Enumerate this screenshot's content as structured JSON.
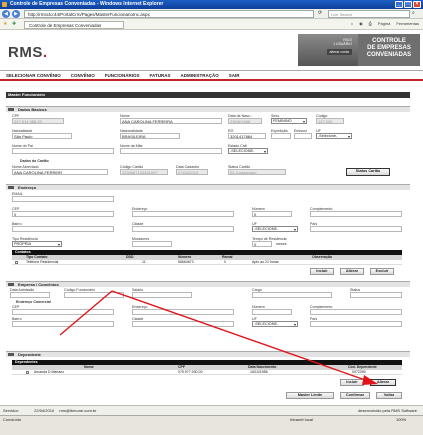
{
  "window": {
    "title": "Controle de Empresas Conveniadas - Windows Internet Explorer"
  },
  "browser": {
    "url": "http://rmscto:44/PortalCrm/Pages/MasterFuncionarioInc.aspx",
    "search_placeholder": "Live Search",
    "tab_label": "Controle de Empresas Conveniadas",
    "page_menu": "Página",
    "tools_menu": "Ferramentas"
  },
  "header": {
    "logo_text": "RMS",
    "user_line1": "RICO",
    "user_line2": "1 USUÁRIO",
    "logout": "alterar conta",
    "system_name_line1": "CONTROLE",
    "system_name_line2": "DE EMPRESAS",
    "system_name_line3": "CONVENIADAS"
  },
  "menu": [
    "SELECIONAR CONVÊNIO",
    "CONVÊNIO",
    "FUNCIONÁRIOS",
    "FATURAS",
    "ADMINISTRAÇÃO",
    "SAIR"
  ],
  "page": {
    "title": "Master Funcionário"
  },
  "dados_basicos": {
    "section": "Dados Básicos",
    "cpf_label": "CPF",
    "cpf": "047.514.988-03",
    "nome_label": "Nome",
    "nome": "ANA CAROLINA FERREIRA",
    "nasc_label": "Data de Nasc.:",
    "nasc": "23/06/1986",
    "sexo_label": "Sexo",
    "sexo": "FEMININO",
    "codigo_label": "Código",
    "codigo": "127.000",
    "natural_label": "Naturalidade",
    "natural": "São Paulo",
    "nacional_label": "Nacionalidade",
    "nacional": "BRASILEIRA",
    "rg_label": "RG",
    "rg": "3201417884",
    "exped_label": "Expedição",
    "emissor_label": "Emissor",
    "uf_label": "UF",
    "uf": "-Selecione-",
    "pai_label": "Nome do Pai",
    "mae_label": "Nome da Mãe",
    "civil_label": "Estado Civil",
    "civil": "-SELECIONE-"
  },
  "cartao": {
    "section": "Dados do Cartão",
    "abrev_label": "Nome Abreviado",
    "abrev": "ANA CAROLINA FERREIR",
    "codigo_label": "Código Cartão",
    "codigo": "1234567123451007",
    "data_label": "Data Cadastro",
    "data": "27/04/2010",
    "status_label": "Status Cartão",
    "status": "00-Cadastrado",
    "status_button": "Status Cartão"
  },
  "endereco": {
    "section": "Endereço",
    "email_label": "EMAIL",
    "cep_label": "CEP",
    "cep": "0",
    "end_label": "Endereço",
    "num_label": "Número",
    "num": "0",
    "comp_label": "Complemento",
    "bairro_label": "Bairro",
    "cidade_label": "Cidade",
    "uf_label": "UF",
    "uf": "-SELECIONE-",
    "pais_label": "País",
    "tipo_label": "Tipo Residência",
    "tipo": "PRÓPRIA",
    "moradores_label": "Moradores",
    "tempo_label": "Tempo de Residência",
    "tempo": "0",
    "tempo_unit": "meses"
  },
  "contatos": {
    "title": "Contatos",
    "headers": [
      "Tipo Contato",
      "DDD",
      "Número",
      "Ramal",
      "Observação"
    ],
    "rows": [
      {
        "tipo": "Telefone Residencial",
        "ddd": "11",
        "numero": "56664673",
        "ramal": "0",
        "obs": "Apto ao 21 horas"
      }
    ],
    "buttons": [
      "Incluir",
      "Alterar",
      "Excluir"
    ]
  },
  "empresa": {
    "section": "Empresa / Convênios",
    "adm_label": "Data Admissão",
    "func_label": "Código Funcionário",
    "salario_label": "Salário",
    "cargo_label": "Cargo",
    "status_label": "Status",
    "end_title": "Endereço Comercial",
    "cep_label": "CEP",
    "end_label": "Endereço",
    "num_label": "Número",
    "comp_label": "Complemento",
    "bairro_label": "Bairro",
    "cidade_label": "Cidade",
    "uf_label": "UF",
    "uf": "-SELECIONE-",
    "pais_label": "País"
  },
  "dependente": {
    "section": "Dependente",
    "title": "Dependentes",
    "headers": [
      "Nome",
      "CPF",
      "Data Nascimento",
      "Cód. Dependente"
    ],
    "rows": [
      {
        "nome": "Amanda D Mariano",
        "cpf": "075.977.930-00",
        "nasc": "16/10/1988",
        "cod": "0072399"
      }
    ],
    "buttons": [
      "Incluir",
      "Alterar"
    ]
  },
  "footer_buttons": [
    "Master Limite",
    "Confirmar",
    "Voltar"
  ],
  "statusbar": {
    "left": "Servidor:",
    "date": "22/04/2010",
    "email": "rms@ibmone.com.br",
    "right": "desenvolvido pela RMS Software"
  },
  "ie_status": {
    "left": "Concluído",
    "zone": "Intranet local",
    "zoom": "100%"
  },
  "colors": {
    "accent": "#c0242b",
    "arrow": "#e0141a"
  }
}
